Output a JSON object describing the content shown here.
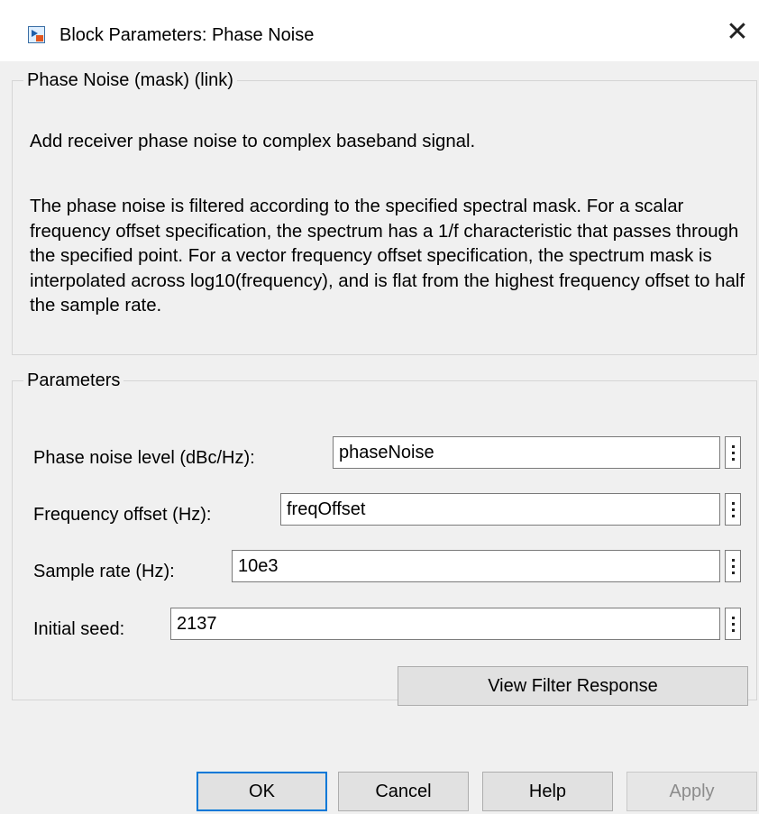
{
  "window": {
    "title": "Block Parameters: Phase Noise",
    "close_glyph": "✕"
  },
  "mask_group": {
    "legend": "Phase Noise (mask) (link)",
    "description_short": "Add receiver phase noise to complex baseband signal.",
    "description_long": "The phase noise is filtered according to the specified spectral mask. For a scalar frequency offset specification, the spectrum has a 1/f characteristic that passes through the specified point. For a vector frequency offset specification, the spectrum mask is interpolated across log10(frequency), and is flat from the highest frequency offset to half the sample rate."
  },
  "params_group": {
    "legend": "Parameters",
    "fields": [
      {
        "label": "Phase noise level (dBc/Hz):",
        "value": "phaseNoise"
      },
      {
        "label": "Frequency offset (Hz):",
        "value": "freqOffset"
      },
      {
        "label": "Sample rate (Hz):",
        "value": "10e3"
      },
      {
        "label": "Initial seed:",
        "value": "2137"
      }
    ],
    "view_filter_label": "View Filter Response"
  },
  "buttons": {
    "ok": "OK",
    "cancel": "Cancel",
    "help": "Help",
    "apply": "Apply"
  },
  "colors": {
    "default_button_border": "#0078d7",
    "disabled_text": "#8c8c8c"
  }
}
